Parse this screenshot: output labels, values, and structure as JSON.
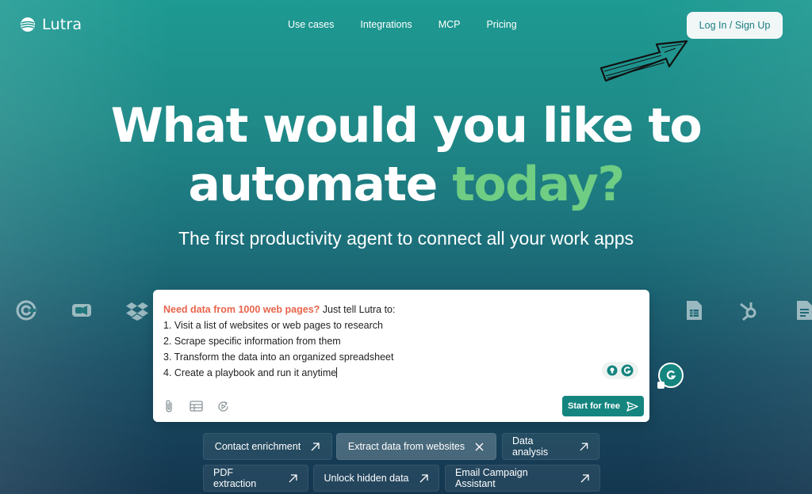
{
  "brand": {
    "name": "Lutra"
  },
  "nav": {
    "items": [
      "Use cases",
      "Integrations",
      "MCP",
      "Pricing"
    ],
    "login_label": "Log In / Sign Up"
  },
  "hero": {
    "title_line1": "What would you like to",
    "title_line2_plain": "automate ",
    "title_line2_accent": "today?",
    "subtitle": "The first productivity agent to connect all your work apps"
  },
  "prompt": {
    "highlight": "Need data from 1000 web pages?",
    "lead": " Just tell Lutra to:",
    "lines": [
      "1. Visit a list of websites or web pages to research",
      "2. Scrape specific information from them",
      "3. Transform the data into an organized spreadsheet",
      "4. Create a playbook and run it anytime"
    ],
    "start_label": "Start for free"
  },
  "chips_row1": [
    {
      "label": "Contact enrichment",
      "icon": "arrow-up-right-icon"
    },
    {
      "label": "Extract data from websites",
      "icon": "close-icon"
    },
    {
      "label": "Data analysis",
      "icon": "arrow-up-right-icon"
    }
  ],
  "chips_row2": [
    {
      "label": "PDF extraction",
      "icon": "arrow-up-right-icon"
    },
    {
      "label": "Unlock hidden data",
      "icon": "arrow-up-right-icon"
    },
    {
      "label": "Email Campaign Assistant",
      "icon": "arrow-up-right-icon"
    }
  ],
  "colors": {
    "accent_green": "#6fcd84",
    "highlight_orange": "#e8654c",
    "button_teal": "#15857f"
  }
}
